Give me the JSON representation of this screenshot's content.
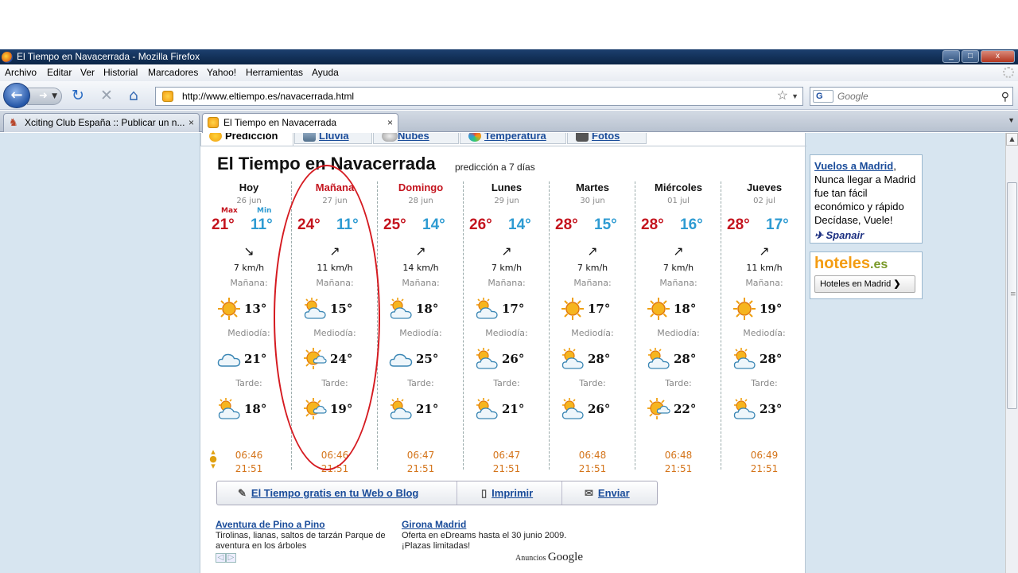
{
  "window": {
    "title": "El Tiempo en Navacerrada - Mozilla Firefox",
    "min": "_",
    "max": "□",
    "close": "x"
  },
  "menu": [
    "Archivo",
    "Editar",
    "Ver",
    "Historial",
    "Marcadores",
    "Yahoo!",
    "Herramientas",
    "Ayuda"
  ],
  "nav": {
    "url": "http://www.eltiempo.es/navacerrada.html",
    "search_placeholder": "Google",
    "search_engine": "G"
  },
  "tabs": [
    {
      "label": "Xciting Club España :: Publicar un n...",
      "close": "×"
    },
    {
      "label": "El Tiempo en Navacerrada",
      "close": "×"
    }
  ],
  "site_tabs": [
    "Predicción",
    "Lluvia",
    "Nubes",
    "Temperatura",
    "Fotos"
  ],
  "forecast": {
    "title": "El Tiempo en Navacerrada",
    "subtitle": "predicción a 7 días",
    "max_label": "Max",
    "min_label": "Min",
    "period_labels": {
      "morning": "Mañana:",
      "midday": "Mediodía:",
      "afternoon": "Tarde:"
    },
    "days": [
      {
        "name": "Hoy",
        "date": "26 jun",
        "max": "21°",
        "min": "11°",
        "wind_arrow": "↘",
        "wind": "7 km/h",
        "morning": "13°",
        "midday": "21°",
        "afternoon": "18°",
        "sunrise": "06:46",
        "sunset": "21:51",
        "icons": [
          "sun",
          "cloud",
          "sun-cloud"
        ]
      },
      {
        "name": "Mañana",
        "date": "27 jun",
        "max": "24°",
        "min": "11°",
        "wind_arrow": "↗",
        "wind": "11 km/h",
        "morning": "15°",
        "midday": "24°",
        "afternoon": "19°",
        "sunrise": "06:46",
        "sunset": "21:51",
        "icons": [
          "sun-cloud",
          "sun-small-cloud",
          "sun-small-cloud"
        ]
      },
      {
        "name": "Domingo",
        "date": "28 jun",
        "max": "25°",
        "min": "14°",
        "wind_arrow": "↗",
        "wind": "14 km/h",
        "morning": "18°",
        "midday": "25°",
        "afternoon": "21°",
        "sunrise": "06:47",
        "sunset": "21:51",
        "icons": [
          "sun-cloud",
          "cloud",
          "sun-cloud"
        ]
      },
      {
        "name": "Lunes",
        "date": "29 jun",
        "max": "26°",
        "min": "14°",
        "wind_arrow": "↗",
        "wind": "7 km/h",
        "morning": "17°",
        "midday": "26°",
        "afternoon": "21°",
        "sunrise": "06:47",
        "sunset": "21:51",
        "icons": [
          "sun-cloud",
          "sun-cloud",
          "sun-cloud"
        ]
      },
      {
        "name": "Martes",
        "date": "30 jun",
        "max": "28°",
        "min": "15°",
        "wind_arrow": "↗",
        "wind": "7 km/h",
        "morning": "17°",
        "midday": "28°",
        "afternoon": "26°",
        "sunrise": "06:48",
        "sunset": "21:51",
        "icons": [
          "sun",
          "sun-cloud",
          "sun-cloud"
        ]
      },
      {
        "name": "Miércoles",
        "date": "01 jul",
        "max": "28°",
        "min": "16°",
        "wind_arrow": "↗",
        "wind": "7 km/h",
        "morning": "18°",
        "midday": "28°",
        "afternoon": "22°",
        "sunrise": "06:48",
        "sunset": "21:51",
        "icons": [
          "sun",
          "sun-cloud",
          "sun-small-cloud"
        ]
      },
      {
        "name": "Jueves",
        "date": "02 jul",
        "max": "28°",
        "min": "17°",
        "wind_arrow": "↗",
        "wind": "11 km/h",
        "morning": "19°",
        "midday": "28°",
        "afternoon": "23°",
        "sunrise": "06:49",
        "sunset": "21:51",
        "icons": [
          "sun",
          "sun-cloud",
          "sun-cloud"
        ]
      }
    ]
  },
  "actions": {
    "widget": "El Tiempo gratis en tu Web o Blog",
    "print": "Imprimir",
    "send": "Enviar"
  },
  "ads": [
    {
      "title": "Aventura de Pino a Pino",
      "text": "Tirolinas, lianas, saltos de tarzán Parque de aventura en los árboles"
    },
    {
      "title": "Girona Madrid",
      "text": "Oferta en eDreams hasta el 30 junio 2009. ¡Plazas limitadas!"
    }
  ],
  "ads_by": {
    "prefix": "Anuncios",
    "brand": "Google"
  },
  "sidebar": {
    "link": "Vuelos a Madrid",
    "text": "Nunca llegar a Madrid fue tan fácil económico y rápido Decídase, Vuele!",
    "brand": "Spanair",
    "hotel_logo": "hoteles",
    "hotel_tld": ".es",
    "hotel_button": "Hoteles en Madrid"
  },
  "colors": {
    "max": "#c4141e",
    "min": "#2e9bd2",
    "sun": "#d4741a",
    "link": "#1a4c9a",
    "annotation": "#d51a20"
  }
}
